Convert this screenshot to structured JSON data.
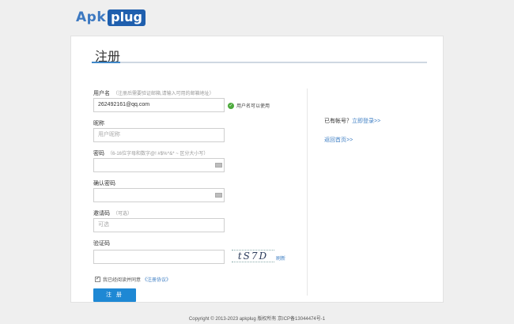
{
  "header": {
    "logo_apk": "Apk",
    "logo_plug": "plug"
  },
  "form": {
    "title": "注册",
    "username": {
      "label": "用户名",
      "hint": "（注册后需要验证邮箱,请输入可用的邮箱地址）",
      "value": "262492161@qq.com",
      "status": "用户名可以使用"
    },
    "nickname": {
      "label": "昵称",
      "placeholder": "用户昵称"
    },
    "password": {
      "label": "密码",
      "hint": "（6-16位字母和数字@! #$%^&* ~ 区分大小写）"
    },
    "confirm_password": {
      "label": "确认密码"
    },
    "invite_code": {
      "label": "邀请码",
      "hint": "（可选）",
      "placeholder": "可选"
    },
    "captcha": {
      "label": "验证码",
      "image_text": "tS7D",
      "refresh": "刷新"
    },
    "agreement": {
      "text": "我已经阅读并同意",
      "link": "《注册协议》"
    },
    "submit_label": "注 册"
  },
  "sidebar": {
    "have_account": "已有帐号？",
    "login_link": "立即登录>>",
    "back_home": "返回首页>>"
  },
  "footer": {
    "copyright": "Copyright © 2013-2023 apkplug 版权所有 京ICP备13044474号-1"
  }
}
